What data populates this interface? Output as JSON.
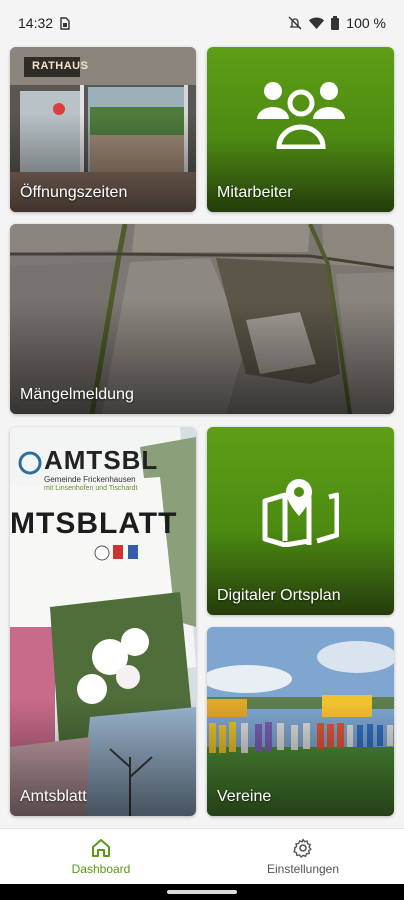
{
  "status_bar": {
    "time": "14:32",
    "battery": "100 %",
    "icons": [
      "sim-icon",
      "mute-icon",
      "wifi-icon",
      "battery-icon"
    ]
  },
  "tiles": [
    {
      "label": "Öffnungszeiten",
      "kind": "photo"
    },
    {
      "label": "Mitarbeiter",
      "kind": "icon",
      "icon": "people-icon"
    },
    {
      "label": "Mängelmeldung",
      "kind": "photo"
    },
    {
      "label": "Amtsblatt",
      "kind": "photo"
    },
    {
      "label": "Digitaler Ortsplan",
      "kind": "icon",
      "icon": "map-pin-icon"
    },
    {
      "label": "Vereine",
      "kind": "photo"
    }
  ],
  "photo_texts": {
    "rathaus_sign": "RATHAUS",
    "amtsblatt_top": "AMTSBL",
    "amtsblatt_main": "MTSBLATT",
    "gemeinde_line1": "Gemeinde Frickenhausen",
    "gemeinde_line2": "mit Linsenhofen und Tischardt"
  },
  "bottom_nav": {
    "active": "dashboard",
    "items": [
      {
        "id": "dashboard",
        "label": "Dashboard",
        "icon": "home-icon"
      },
      {
        "id": "settings",
        "label": "Einstellungen",
        "icon": "gear-icon"
      }
    ]
  },
  "colors": {
    "accent": "#5a9a14",
    "nav_active": "#5a9a14",
    "nav_inactive": "#555555"
  }
}
